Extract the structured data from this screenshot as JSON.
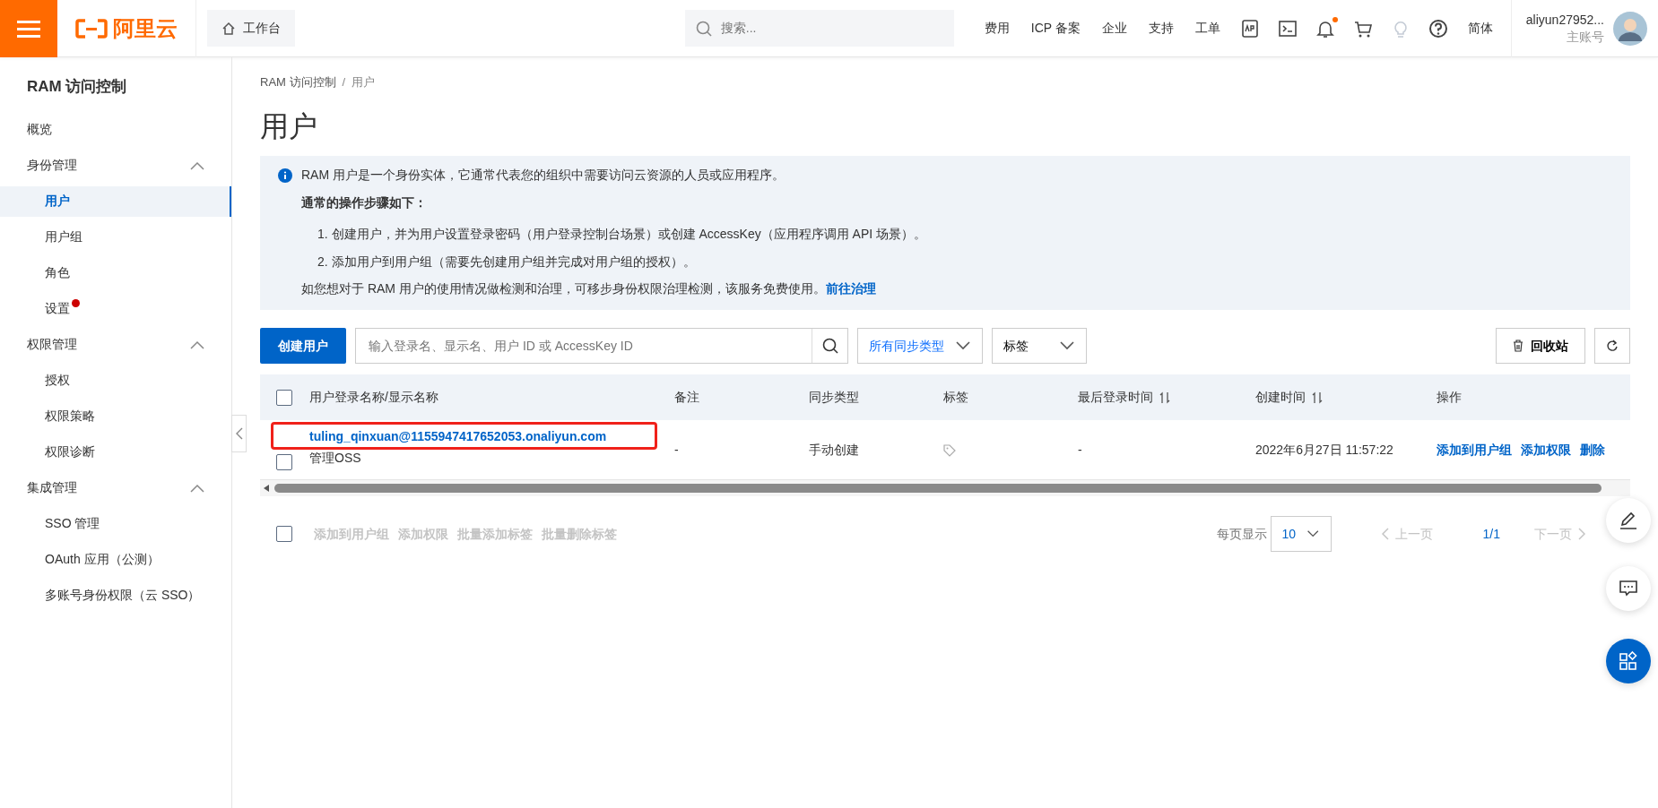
{
  "topbar": {
    "logo": "阿里云",
    "workbench": "工作台",
    "search": {
      "placeholder": "搜索..."
    },
    "links": [
      "费用",
      "ICP 备案",
      "企业",
      "支持",
      "工单"
    ],
    "icons": [
      {
        "kind": "app",
        "dot": false,
        "disabled": false
      },
      {
        "kind": "terminal",
        "dot": false,
        "disabled": false
      },
      {
        "kind": "bell",
        "dot": true,
        "disabled": false
      },
      {
        "kind": "cart",
        "dot": false,
        "disabled": false
      },
      {
        "kind": "bulb",
        "dot": false,
        "disabled": true
      },
      {
        "kind": "help",
        "dot": false,
        "disabled": false
      }
    ],
    "language": "简体",
    "account": {
      "name": "aliyun27952...",
      "role": "主账号"
    }
  },
  "sidebar": {
    "title": "RAM 访问控制",
    "items": [
      {
        "label": "概览",
        "selected": false,
        "dot": false
      },
      {
        "label": "身份管理",
        "expanded": true,
        "children": [
          {
            "label": "用户",
            "selected": true,
            "dot": false
          },
          {
            "label": "用户组",
            "selected": false,
            "dot": false
          },
          {
            "label": "角色",
            "selected": false,
            "dot": false
          },
          {
            "label": "设置",
            "selected": false,
            "dot": true
          }
        ]
      },
      {
        "label": "权限管理",
        "expanded": true,
        "children": [
          {
            "label": "授权",
            "selected": false,
            "dot": false
          },
          {
            "label": "权限策略",
            "selected": false,
            "dot": false
          },
          {
            "label": "权限诊断",
            "selected": false,
            "dot": false
          }
        ]
      },
      {
        "label": "集成管理",
        "expanded": true,
        "children": [
          {
            "label": "SSO 管理",
            "selected": false,
            "dot": false
          },
          {
            "label": "OAuth 应用（公测）",
            "selected": false,
            "dot": false
          },
          {
            "label": "多账号身份权限（云 SSO）",
            "selected": false,
            "dot": false
          }
        ]
      }
    ]
  },
  "breadcrumb": [
    "RAM 访问控制",
    "/",
    "用户"
  ],
  "page_title": "用户",
  "info": {
    "intro": "RAM 用户是一个身份实体，它通常代表您的组织中需要访问云资源的人员或应用程序。",
    "steps_title": "通常的操作步骤如下：",
    "steps": [
      "1. 创建用户，并为用户设置登录密码（用户登录控制台场景）或创建 AccessKey（应用程序调用 API 场景）。",
      "2. 添加用户到用户组（需要先创建用户组并完成对用户组的授权）。"
    ],
    "note": "如您想对于 RAM 用户的使用情况做检测和治理，可移步身份权限治理检测，该服务免费使用。",
    "link": "前往治理"
  },
  "toolbar": {
    "create": "创建用户",
    "search": {
      "placeholder": "输入登录名、显示名、用户 ID 或 AccessKey ID"
    },
    "sync_filter": "所有同步类型",
    "tag_filter": "标签",
    "recycle": "回收站"
  },
  "table": {
    "select_all_checked": false,
    "columns": [
      {
        "label": "用户登录名称/显示名称",
        "sortable": false
      },
      {
        "label": "备注",
        "sortable": false
      },
      {
        "label": "同步类型",
        "sortable": false
      },
      {
        "label": "标签",
        "sortable": false
      },
      {
        "label": "最后登录时间",
        "sortable": true
      },
      {
        "label": "创建时间",
        "sortable": true
      },
      {
        "label": "操作",
        "sortable": false
      }
    ],
    "rows": [
      {
        "checked": false,
        "highlighted": true,
        "login": "tuling_qinxuan@1155947417652053.onaliyun.com",
        "display": "管理OSS",
        "note": "-",
        "sync": "手动创建",
        "last_login": "-",
        "created": "2022年6月27日 11:57:22",
        "actions": [
          "添加到用户组",
          "添加权限",
          "删除"
        ]
      }
    ]
  },
  "bulk": {
    "checked": false,
    "actions": [
      "添加到用户组",
      "添加权限",
      "批量添加标签",
      "批量删除标签"
    ]
  },
  "pagination": {
    "per_page_label": "每页显示",
    "per_page": "10",
    "prev": "上一页",
    "page": "1/1",
    "next": "下一页",
    "prev_disabled": true,
    "next_disabled": true
  }
}
